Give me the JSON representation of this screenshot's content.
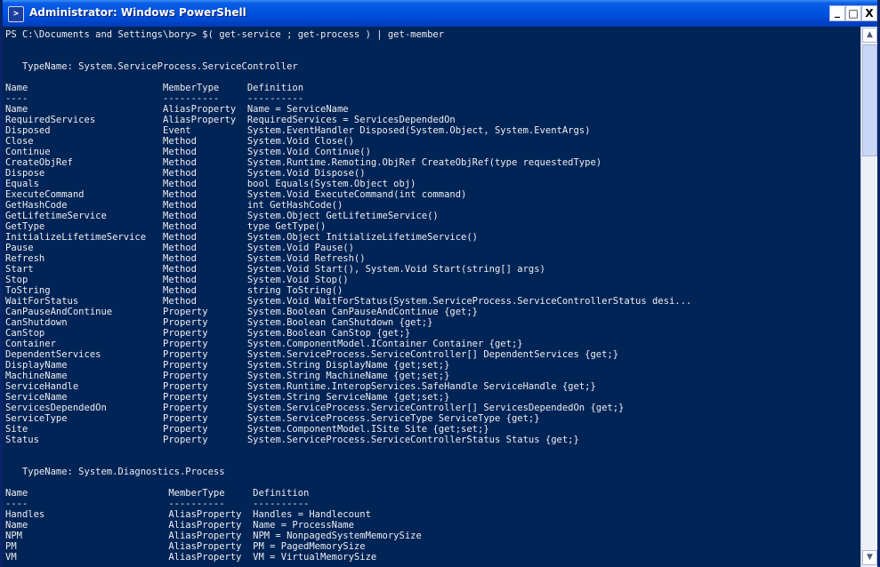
{
  "window": {
    "title": "Administrator: Windows PowerShell",
    "icon_label": ">",
    "controls": {
      "minimize": "_",
      "maximize": "□",
      "close": "X"
    }
  },
  "console": {
    "lines": [
      "PS C:\\Documents and Settings\\bory> $( get-service ; get-process ) | get-member",
      "",
      "",
      "   TypeName: System.ServiceProcess.ServiceController",
      "",
      "Name                        MemberType     Definition",
      "----                        ----------     ----------",
      "Name                        AliasProperty  Name = ServiceName",
      "RequiredServices            AliasProperty  RequiredServices = ServicesDependedOn",
      "Disposed                    Event          System.EventHandler Disposed(System.Object, System.EventArgs)",
      "Close                       Method         System.Void Close()",
      "Continue                    Method         System.Void Continue()",
      "CreateObjRef                Method         System.Runtime.Remoting.ObjRef CreateObjRef(type requestedType)",
      "Dispose                     Method         System.Void Dispose()",
      "Equals                      Method         bool Equals(System.Object obj)",
      "ExecuteCommand              Method         System.Void ExecuteCommand(int command)",
      "GetHashCode                 Method         int GetHashCode()",
      "GetLifetimeService          Method         System.Object GetLifetimeService()",
      "GetType                     Method         type GetType()",
      "InitializeLifetimeService   Method         System.Object InitializeLifetimeService()",
      "Pause                       Method         System.Void Pause()",
      "Refresh                     Method         System.Void Refresh()",
      "Start                       Method         System.Void Start(), System.Void Start(string[] args)",
      "Stop                        Method         System.Void Stop()",
      "ToString                    Method         string ToString()",
      "WaitForStatus               Method         System.Void WaitForStatus(System.ServiceProcess.ServiceControllerStatus desi...",
      "CanPauseAndContinue         Property       System.Boolean CanPauseAndContinue {get;}",
      "CanShutdown                 Property       System.Boolean CanShutdown {get;}",
      "CanStop                     Property       System.Boolean CanStop {get;}",
      "Container                   Property       System.ComponentModel.IContainer Container {get;}",
      "DependentServices           Property       System.ServiceProcess.ServiceController[] DependentServices {get;}",
      "DisplayName                 Property       System.String DisplayName {get;set;}",
      "MachineName                 Property       System.String MachineName {get;set;}",
      "ServiceHandle               Property       System.Runtime.InteropServices.SafeHandle ServiceHandle {get;}",
      "ServiceName                 Property       System.String ServiceName {get;set;}",
      "ServicesDependedOn          Property       System.ServiceProcess.ServiceController[] ServicesDependedOn {get;}",
      "ServiceType                 Property       System.ServiceProcess.ServiceType ServiceType {get;}",
      "Site                        Property       System.ComponentModel.ISite Site {get;set;}",
      "Status                      Property       System.ServiceProcess.ServiceControllerStatus Status {get;}",
      "",
      "",
      "   TypeName: System.Diagnostics.Process",
      "",
      "Name                         MemberType     Definition",
      "----                         ----------     ----------",
      "Handles                      AliasProperty  Handles = Handlecount",
      "Name                         AliasProperty  Name = ProcessName",
      "NPM                          AliasProperty  NPM = NonpagedSystemMemorySize",
      "PM                           AliasProperty  PM = PagedMemorySize",
      "VM                           AliasProperty  VM = VirtualMemorySize"
    ]
  },
  "scrollbar": {
    "up_arrow": "▲",
    "down_arrow": "▼"
  },
  "colors": {
    "console_bg": "#012456",
    "console_fg": "#eeedf0",
    "titlebar": "#0054e3"
  }
}
